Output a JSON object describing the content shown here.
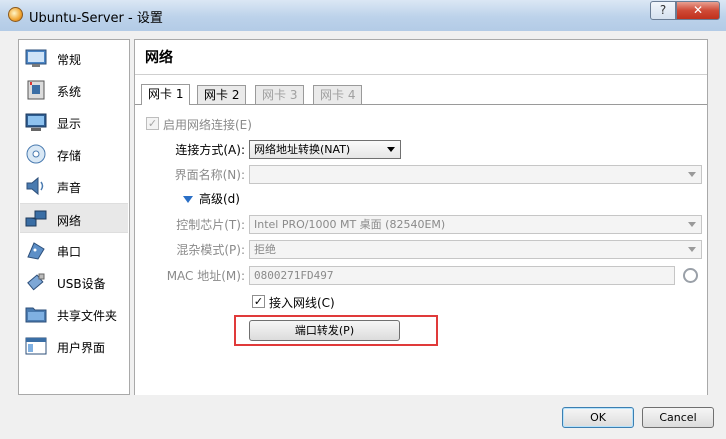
{
  "window": {
    "title": "Ubuntu-Server - 设置",
    "help_label": "?",
    "close_label": "✕"
  },
  "sidebar": {
    "items": [
      {
        "label": "常规",
        "icon": "general-icon"
      },
      {
        "label": "系统",
        "icon": "system-icon"
      },
      {
        "label": "显示",
        "icon": "display-icon"
      },
      {
        "label": "存储",
        "icon": "storage-icon"
      },
      {
        "label": "声音",
        "icon": "audio-icon"
      },
      {
        "label": "网络",
        "icon": "network-icon",
        "selected": true
      },
      {
        "label": "串口",
        "icon": "serial-port-icon"
      },
      {
        "label": "USB设备",
        "icon": "usb-icon"
      },
      {
        "label": "共享文件夹",
        "icon": "shared-folder-icon"
      },
      {
        "label": "用户界面",
        "icon": "user-interface-icon"
      }
    ]
  },
  "main": {
    "title": "网络",
    "tabs": [
      {
        "label": "网卡 1",
        "state": "active"
      },
      {
        "label": "网卡 2",
        "state": "enabled"
      },
      {
        "label": "网卡 3",
        "state": "disabled"
      },
      {
        "label": "网卡 4",
        "state": "disabled"
      }
    ],
    "enable_adapter": {
      "label": "启用网络连接(E)",
      "checked": true,
      "disabled": true
    },
    "attached_to": {
      "label": "连接方式(A):",
      "value": "网络地址转换(NAT)"
    },
    "name": {
      "label": "界面名称(N):",
      "value": ""
    },
    "advanced": {
      "label": "高级(d)"
    },
    "adapter_type": {
      "label": "控制芯片(T):",
      "value": "Intel PRO/1000 MT 桌面 (82540EM)"
    },
    "promiscuous": {
      "label": "混杂模式(P):",
      "value": "拒绝"
    },
    "mac": {
      "label": "MAC 地址(M):",
      "value": "0800271FD497"
    },
    "cable": {
      "label": "接入网线(C)",
      "checked": true
    },
    "port_forwarding": {
      "label": "端口转发(P)"
    }
  },
  "footer": {
    "ok_label": "OK",
    "cancel_label": "Cancel"
  },
  "colors": {
    "highlight_box": "#e03a3a",
    "accent_blue": "#2a6fc6"
  }
}
